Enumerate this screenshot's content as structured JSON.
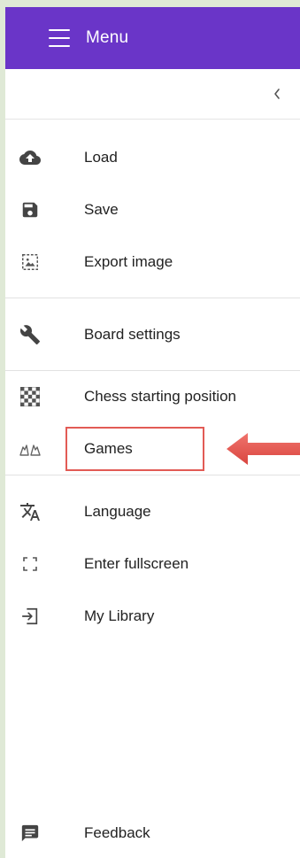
{
  "header": {
    "title": "Menu",
    "background_color": "#6a35c8",
    "icon": "hamburger-menu-icon"
  },
  "collapse": {
    "icon": "chevron-left-icon"
  },
  "menu": {
    "items": [
      {
        "label": "Load",
        "icon": "cloud-upload-icon"
      },
      {
        "label": "Save",
        "icon": "floppy-disk-icon"
      },
      {
        "label": "Export image",
        "icon": "image-export-icon"
      },
      {
        "label": "Board settings",
        "icon": "wrench-icon"
      },
      {
        "label": "Chess starting position",
        "icon": "checkerboard-icon"
      },
      {
        "label": "Games",
        "icon": "chess-pieces-icon",
        "highlighted": true
      },
      {
        "label": "Language",
        "icon": "translate-icon"
      },
      {
        "label": "Enter fullscreen",
        "icon": "fullscreen-icon"
      },
      {
        "label": "My Library",
        "icon": "library-login-icon"
      }
    ]
  },
  "footer": {
    "feedback_label": "Feedback",
    "icon": "feedback-icon"
  },
  "annotation": {
    "highlight_color": "#e25b55",
    "arrow_icon": "red-arrow-left-icon"
  }
}
